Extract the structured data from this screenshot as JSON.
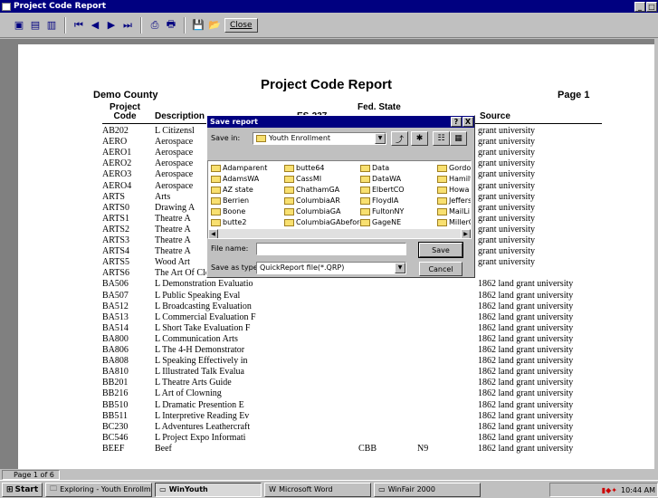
{
  "window": {
    "title": "Project Code Report",
    "controls": [
      "_",
      "□"
    ]
  },
  "toolbar": {
    "close_label": "Close"
  },
  "report": {
    "title": "Project Code Report",
    "county": "Demo County",
    "page": "Page 1",
    "headers": {
      "project_code": "Project Code",
      "description": "Description",
      "es237": "ES-237",
      "fed_state": "Fed. State",
      "source": "Source"
    },
    "rows": [
      {
        "code": "AB202",
        "desc": "L Citizensl",
        "es": "",
        "fed": "",
        "src": "grant university"
      },
      {
        "code": "AERO",
        "desc": "Aerospace",
        "es": "",
        "fed": "",
        "src": "grant university"
      },
      {
        "code": "AERO1",
        "desc": "Aerospace",
        "es": "",
        "fed": "",
        "src": "grant university"
      },
      {
        "code": "AERO2",
        "desc": "Aerospace",
        "es": "",
        "fed": "",
        "src": "grant university"
      },
      {
        "code": "AERO3",
        "desc": "Aerospace",
        "es": "",
        "fed": "",
        "src": "grant university"
      },
      {
        "code": "AERO4",
        "desc": "Aerospace",
        "es": "",
        "fed": "",
        "src": "grant university"
      },
      {
        "code": "ARTS",
        "desc": "Arts",
        "es": "",
        "fed": "",
        "src": "grant university"
      },
      {
        "code": "ARTS0",
        "desc": "Drawing A",
        "es": "",
        "fed": "",
        "src": "grant university"
      },
      {
        "code": "ARTS1",
        "desc": "Theatre A",
        "es": "",
        "fed": "",
        "src": "grant university"
      },
      {
        "code": "ARTS2",
        "desc": "Theatre A",
        "es": "",
        "fed": "",
        "src": "grant university"
      },
      {
        "code": "ARTS3",
        "desc": "Theatre A",
        "es": "",
        "fed": "",
        "src": "grant university"
      },
      {
        "code": "ARTS4",
        "desc": "Theatre A",
        "es": "",
        "fed": "",
        "src": "grant university"
      },
      {
        "code": "ARTS5",
        "desc": "Wood Art",
        "es": "",
        "fed": "",
        "src": "grant university"
      },
      {
        "code": "ARTS6",
        "desc": "The Art Of Clowning",
        "es": "",
        "fed": "",
        "src": ""
      },
      {
        "code": "BA506",
        "desc": "L Demonstration Evaluatio",
        "es": "",
        "fed": "",
        "src": "1862 land grant university"
      },
      {
        "code": "BA507",
        "desc": "L Public Speaking Eval",
        "es": "",
        "fed": "",
        "src": "1862 land grant university"
      },
      {
        "code": "BA512",
        "desc": "L Broadcasting Evaluation",
        "es": "",
        "fed": "",
        "src": "1862 land grant university"
      },
      {
        "code": "BA513",
        "desc": "L Commercial Evaluation F",
        "es": "",
        "fed": "",
        "src": "1862 land grant university"
      },
      {
        "code": "BA514",
        "desc": "L Short Take Evaluation F",
        "es": "",
        "fed": "",
        "src": "1862 land grant university"
      },
      {
        "code": "BA800",
        "desc": "L Communication Arts",
        "es": "",
        "fed": "",
        "src": "1862 land grant university"
      },
      {
        "code": "BA806",
        "desc": "L The 4-H Demonstrator",
        "es": "",
        "fed": "",
        "src": "1862 land grant university"
      },
      {
        "code": "BA808",
        "desc": "L Speaking Effectively in",
        "es": "",
        "fed": "",
        "src": "1862 land grant university"
      },
      {
        "code": "BA810",
        "desc": "L Illustrated Talk Evalua",
        "es": "",
        "fed": "",
        "src": "1862 land grant university"
      },
      {
        "code": "BB201",
        "desc": "L Theatre Arts Guide",
        "es": "",
        "fed": "",
        "src": "1862 land grant university"
      },
      {
        "code": "BB216",
        "desc": "L Art of Clowning",
        "es": "",
        "fed": "",
        "src": "1862 land grant university"
      },
      {
        "code": "BB510",
        "desc": "L Dramatic Presention E",
        "es": "",
        "fed": "",
        "src": "1862 land grant university"
      },
      {
        "code": "BB511",
        "desc": "L Interpretive Reading Ev",
        "es": "",
        "fed": "",
        "src": "1862 land grant university"
      },
      {
        "code": "BC230",
        "desc": "L Adventures Leathercraft",
        "es": "",
        "fed": "",
        "src": "1862 land grant university"
      },
      {
        "code": "BC546",
        "desc": "L Project Expo Informati",
        "es": "",
        "fed": "",
        "src": "1862 land grant university"
      },
      {
        "code": "BEEF",
        "desc": "Beef",
        "es": "CBB",
        "fed": "N9",
        "src": "1862 land grant university"
      }
    ]
  },
  "dialog": {
    "title": "Save report",
    "help": "?",
    "close": "X",
    "save_in_label": "Save in:",
    "save_in_value": "Youth Enrollment",
    "folders": [
      [
        "Adamparent",
        "AdamsWA",
        "AZ state",
        "Berrien",
        "Boone",
        "butte2"
      ],
      [
        "butte64",
        "CassMI",
        "ChathamGA",
        "ColumbiaAR",
        "ColumbiaGA",
        "ColumbiaGAbefore"
      ],
      [
        "Data",
        "DataWA",
        "ElbertCO",
        "FloydIA",
        "FultonNY",
        "GageNE"
      ],
      [
        "Gordo",
        "Hamilt",
        "Howa",
        "Jeffers",
        "MailLi",
        "MillerC"
      ]
    ],
    "file_name_label": "File name:",
    "file_name_value": "",
    "save_as_label": "Save as type:",
    "save_as_value": "QuickReport file(*.QRP)",
    "save_button": "Save",
    "cancel_button": "Cancel"
  },
  "status": {
    "page": "Page 1 of 6"
  },
  "taskbar": {
    "start": "Start",
    "tasks": [
      "Exploring - Youth Enrollment",
      "WinYouth",
      "Microsoft Word",
      "WinFair 2000"
    ],
    "clock": "10:44 AM"
  }
}
